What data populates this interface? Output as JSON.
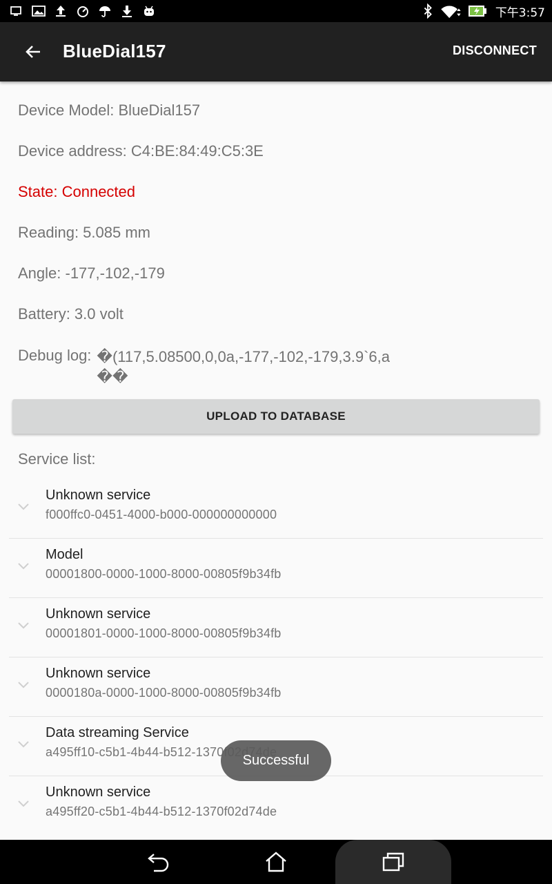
{
  "status_bar": {
    "time": "下午3:57",
    "left_icons": [
      "screen-icon",
      "image-icon",
      "upload-icon",
      "gauge-icon",
      "umbrella-icon",
      "download-icon",
      "android-icon"
    ],
    "right_icons": [
      "bluetooth-icon",
      "wifi-icon",
      "battery-charging-icon"
    ]
  },
  "app_bar": {
    "title": "BlueDial157",
    "action": "DISCONNECT"
  },
  "device": {
    "model": "Device Model: BlueDial157",
    "address": "Device address: C4:BE:84:49:C5:3E",
    "state": "State: Connected",
    "reading": "Reading: 5.085 mm",
    "angle": "Angle: -177,-102,-179",
    "battery": "Battery: 3.0 volt",
    "debug_label": "Debug log:",
    "debug_value": "�(117,5.08500,0,0a,-177,-102,-179,3.9`6,a\n��"
  },
  "upload_button": "UPLOAD TO DATABASE",
  "service_list_label": "Service list:",
  "services": [
    {
      "name": "Unknown service",
      "uuid": "f000ffc0-0451-4000-b000-000000000000"
    },
    {
      "name": "Model",
      "uuid": "00001800-0000-1000-8000-00805f9b34fb"
    },
    {
      "name": "Unknown service",
      "uuid": "00001801-0000-1000-8000-00805f9b34fb"
    },
    {
      "name": "Unknown service",
      "uuid": "0000180a-0000-1000-8000-00805f9b34fb"
    },
    {
      "name": "Data streaming Service",
      "uuid": "a495ff10-c5b1-4b44-b512-1370f02d74de"
    },
    {
      "name": "Unknown service",
      "uuid": "a495ff20-c5b1-4b44-b512-1370f02d74de"
    }
  ],
  "toast": "Successful",
  "colors": {
    "app_bar": "#212121",
    "state": "#d50000",
    "button": "#d6d7d7",
    "text_secondary": "#737373"
  }
}
